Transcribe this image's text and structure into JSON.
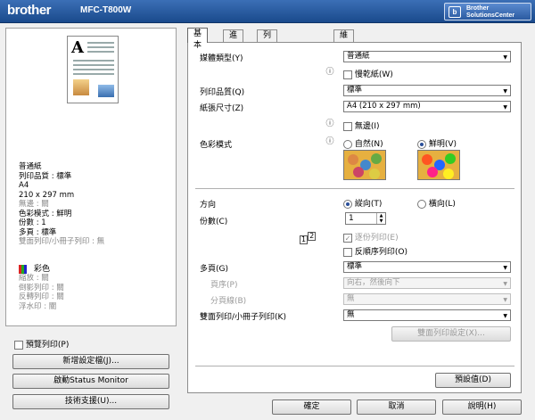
{
  "header": {
    "brand": "brother",
    "model": "MFC-T800W",
    "solutions_top": "Brother",
    "solutions_bottom": "SolutionsCenter"
  },
  "left": {
    "summary": [
      "普通紙",
      "列印品質 : 標準",
      "A4",
      "210 x 297 mm"
    ],
    "summary_gray": [
      "無邊 : 關"
    ],
    "summary2": [
      "色彩模式 : 鮮明",
      "份數 : 1",
      "多頁 : 標準"
    ],
    "summary2_gray": [
      "雙面列印/小冊子列印 : 無"
    ],
    "color_label": "彩色",
    "settings_gray": [
      "縮放 : 關",
      "倒影列印 : 關",
      "反轉列印 : 關",
      "浮水印 : 關"
    ],
    "preview_label": "預覽列印(P)",
    "add_profile": "新增設定檔(J)...",
    "status_monitor": "啟動Status Monitor",
    "support": "技術支援(U)..."
  },
  "tabs": [
    "基本",
    "進階",
    "列印設定檔",
    "維護"
  ],
  "basic": {
    "media_label": "媒體類型(Y)",
    "media_value": "普通紙",
    "slow_dry": "慢乾紙(W)",
    "quality_label": "列印品質(Q)",
    "quality_value": "標準",
    "paper_label": "紙張尺寸(Z)",
    "paper_value": "A4 (210 x 297 mm)",
    "borderless": "無邊(I)",
    "color_label": "色彩模式",
    "natural": "自然(N)",
    "vivid": "鮮明(V)",
    "orient_label": "方向",
    "portrait": "縱向(T)",
    "landscape": "橫向(L)",
    "copies_label": "份數(C)",
    "copies_value": "1",
    "collate": "逐份列印(E)",
    "reverse": "反順序列印(O)",
    "multipage_label": "多頁(G)",
    "multipage_value": "標準",
    "order_label": "頁序(P)",
    "order_value": "向右，然後向下",
    "border_label": "分頁線(B)",
    "border_value": "無",
    "duplex_label": "雙面列印/小冊子列印(K)",
    "duplex_value": "無",
    "duplex_settings": "雙面列印設定(X)...",
    "defaults": "預設值(D)"
  },
  "footer": {
    "ok": "確定",
    "cancel": "取消",
    "help": "說明(H)"
  }
}
